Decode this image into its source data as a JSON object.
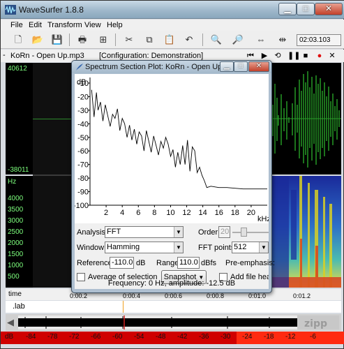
{
  "app": {
    "title": "WaveSurfer 1.8.8",
    "menu": [
      "File",
      "Edit",
      "Transform",
      "View",
      "Help"
    ],
    "toolbar_icons": [
      "new-icon",
      "open-icon",
      "save-icon",
      "print-icon",
      "properties-icon",
      "cut-icon",
      "copy-icon",
      "paste-icon",
      "undo-icon",
      "zoom-in-icon",
      "zoom-out-icon",
      "zoom-all-icon",
      "zoom-selection-icon"
    ],
    "time": "02:03.103"
  },
  "file_bar": {
    "file_name": "KoRn - Open Up.mp3",
    "configuration": "[Configuration: Demonstration]"
  },
  "panes": {
    "waveform_top": "40612",
    "waveform_bottom": "-38011",
    "spec_unit": "Hz",
    "spec_ticks": [
      "4000",
      "3500",
      "3000",
      "2500",
      "2000",
      "1500",
      "1000",
      "500"
    ],
    "time_label": "time",
    "time_ticks": [
      "0:00.2",
      "0:00.4",
      "0:00.6",
      "0:00.8",
      "0:01.0",
      "0:01.2"
    ],
    "label_track": ".lab"
  },
  "db_scale": [
    "dB",
    "-84",
    "-78",
    "-72",
    "-66",
    "-60",
    "-54",
    "-48",
    "-42",
    "-36",
    "-30",
    "-24",
    "-18",
    "-12",
    "-6"
  ],
  "dialog": {
    "title": "Spectrum Section Plot: KoRn - Open Up...",
    "analysis_label": "Analysis:",
    "analysis_value": "FFT",
    "order_label": "Order:",
    "order_value": "20",
    "window_label": "Window:",
    "window_value": "Hamming",
    "fft_points_label": "FFT points:",
    "fft_points_value": "512",
    "reference_label": "Reference:",
    "reference_value": "-110.0",
    "reference_unit": "dB",
    "range_label": "Range:",
    "range_value": "110.0",
    "range_unit": "dBfs",
    "preemphasis_label": "Pre-emphasis:",
    "average_label": "Average of selection",
    "snapshot_label": "Snapshot",
    "add_header_label": "Add file heade",
    "status": "Frequency: 0 Hz, amplitude: -12.5 dB"
  },
  "chart_data": {
    "type": "line",
    "ylabel": "dB",
    "xlabel": "kHz",
    "ylim": [
      -100,
      -10
    ],
    "xlim": [
      0,
      22
    ],
    "y_ticks": [
      "-10",
      "-20",
      "-30",
      "-40",
      "-50",
      "-60",
      "-70",
      "-80",
      "-90",
      "-100"
    ],
    "x_ticks": [
      "2",
      "4",
      "6",
      "8",
      "10",
      "12",
      "14",
      "16",
      "18",
      "20"
    ],
    "x": [
      0.2,
      0.5,
      0.8,
      1.0,
      1.3,
      1.6,
      1.9,
      2.2,
      2.5,
      2.8,
      3.1,
      3.4,
      3.7,
      4.0,
      4.3,
      4.6,
      4.9,
      5.2,
      5.5,
      5.8,
      6.1,
      6.4,
      6.7,
      7.0,
      7.3,
      7.6,
      7.9,
      8.2,
      8.5,
      8.8,
      9.1,
      9.4,
      9.7,
      10.0,
      10.3,
      10.6,
      10.9,
      11.2,
      11.5,
      11.8,
      12.1,
      12.4,
      12.7,
      13.0,
      13.3,
      13.6,
      13.9,
      14.2,
      14.5,
      15.0,
      16.0,
      17.0,
      18.0,
      19.0,
      20.0,
      21.0,
      22.0
    ],
    "y": [
      -15,
      -35,
      -17,
      -30,
      -24,
      -38,
      -26,
      -34,
      -42,
      -33,
      -36,
      -29,
      -45,
      -36,
      -40,
      -50,
      -41,
      -52,
      -44,
      -55,
      -46,
      -49,
      -60,
      -45,
      -53,
      -61,
      -49,
      -56,
      -63,
      -53,
      -58,
      -50,
      -55,
      -64,
      -59,
      -72,
      -61,
      -70,
      -56,
      -70,
      -52,
      -75,
      -57,
      -60,
      -76,
      -72,
      -78,
      -82,
      -87,
      -86,
      -87,
      -87,
      -87.5,
      -88,
      -88,
      -88,
      -88
    ]
  }
}
